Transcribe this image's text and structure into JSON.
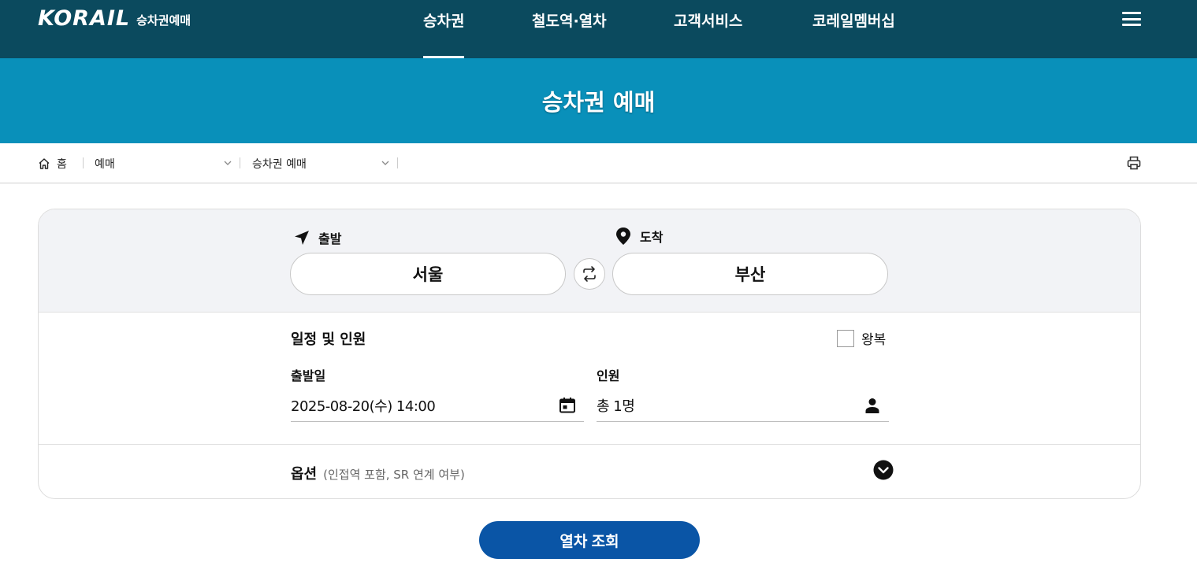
{
  "header": {
    "logo_word": "KORAIL",
    "logo_sub": "승차권예매",
    "nav": [
      {
        "label": "승차권",
        "active": true
      },
      {
        "label": "철도역·열차",
        "active": false
      },
      {
        "label": "고객서비스",
        "active": false
      },
      {
        "label": "코레일멤버십",
        "active": false
      }
    ],
    "menu_icon": "hamburger-icon"
  },
  "title_band": {
    "title": "승차권 예매"
  },
  "breadcrumb": {
    "home": "홈",
    "level1": "예매",
    "level2": "승차권 예매",
    "print_icon": "print-icon"
  },
  "search": {
    "departure_label": "출발",
    "departure_value": "서울",
    "arrival_label": "도착",
    "arrival_value": "부산",
    "swap_icon": "swap-icon",
    "schedule_title": "일정 및 인원",
    "roundtrip_label": "왕복",
    "roundtrip_checked": false,
    "date_label": "출발일",
    "date_value": "2025-08-20(수) 14:00",
    "passenger_label": "인원",
    "passenger_value": "총 1명",
    "options_label": "옵션",
    "options_hint": "(인접역 포함, SR 연계 여부)",
    "submit_label": "열차 조회"
  },
  "colors": {
    "topbar": "#0b4a5e",
    "title_band": "#0990ba",
    "primary_button": "#0a55a6",
    "card_top": "#f2f3f6"
  }
}
